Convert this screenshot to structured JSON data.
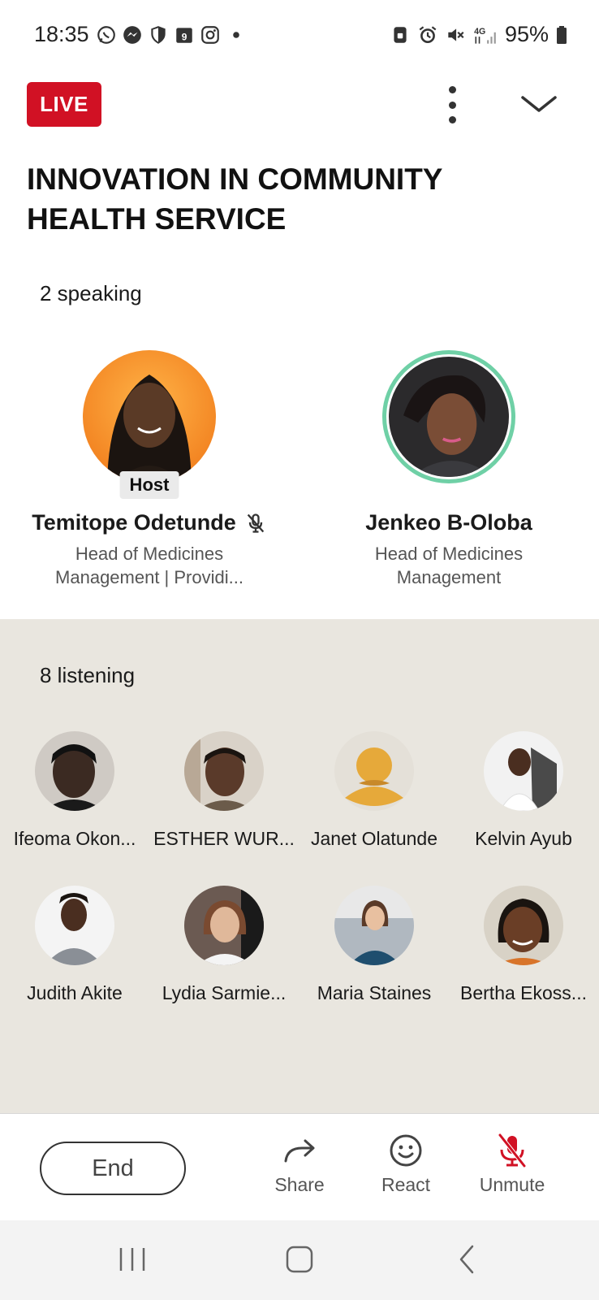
{
  "status_bar": {
    "time": "18:35",
    "battery": "95%",
    "left_icons": [
      "whatsapp-icon",
      "messenger-icon",
      "shield-icon",
      "calendar-icon",
      "instagram-icon",
      "dot-icon"
    ],
    "right_icons": [
      "lock-icon",
      "alarm-icon",
      "mute-icon",
      "signal-4g-icon",
      "battery-icon"
    ],
    "calendar_day": "9"
  },
  "header": {
    "live_label": "LIVE",
    "title": "INNOVATION IN COMMUNITY HEALTH SERVICE"
  },
  "speakers": {
    "count_label": "2 speaking",
    "items": [
      {
        "name": "Temitope Odetunde",
        "tag": "Host",
        "headline": "Head of Medicines Management  | Providi...",
        "muted": true
      },
      {
        "name": "Jenkeo B-Oloba",
        "headline": "Head of Medicines Management",
        "speaking": true
      }
    ]
  },
  "listeners": {
    "count_label": "8 listening",
    "items": [
      {
        "name": "Ifeoma Okon..."
      },
      {
        "name": "ESTHER WUR..."
      },
      {
        "name": "Janet Olatunde"
      },
      {
        "name": "Kelvin Ayub"
      },
      {
        "name": "Judith Akite"
      },
      {
        "name": "Lydia Sarmie..."
      },
      {
        "name": "Maria Staines"
      },
      {
        "name": "Bertha Ekoss..."
      }
    ]
  },
  "actions": {
    "end_label": "End",
    "share_label": "Share",
    "react_label": "React",
    "unmute_label": "Unmute"
  },
  "colors": {
    "live_red": "#d11124",
    "speaking_ring": "#6fd0a6",
    "listeners_bg": "#e9e6df",
    "mic_red": "#d11124",
    "placeholder_avatar": "#e6a93a"
  }
}
